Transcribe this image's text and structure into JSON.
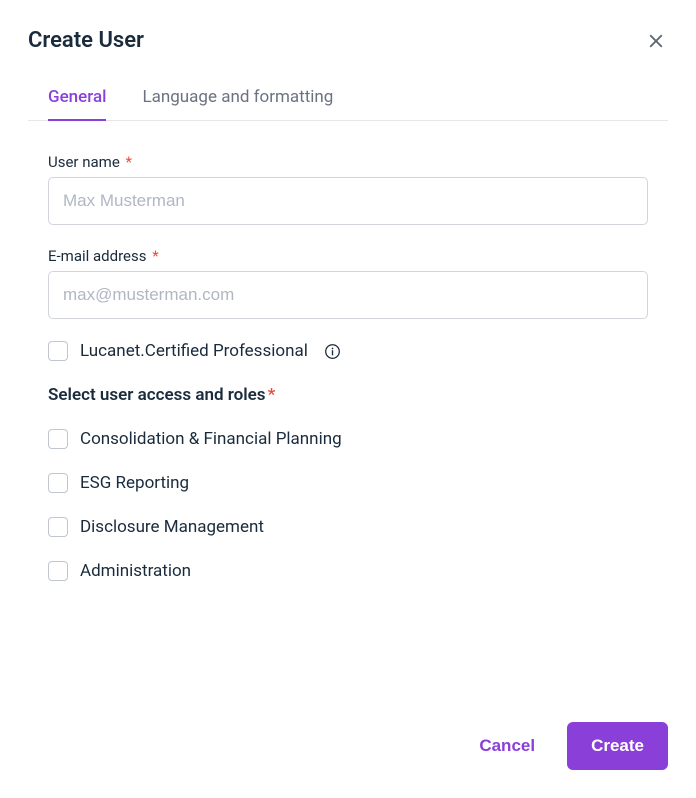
{
  "dialog": {
    "title": "Create User"
  },
  "tabs": {
    "general": "General",
    "language": "Language and formatting"
  },
  "fields": {
    "username": {
      "label": "User name",
      "placeholder": "Max Musterman"
    },
    "email": {
      "label": "E-mail address",
      "placeholder": "max@musterman.com"
    },
    "certified": {
      "label": "Lucanet.Certified Professional"
    }
  },
  "rolesHeading": "Select user access and roles",
  "roles": {
    "consolidation": "Consolidation & Financial Planning",
    "esg": "ESG Reporting",
    "disclosure": "Disclosure Management",
    "administration": "Administration"
  },
  "buttons": {
    "cancel": "Cancel",
    "create": "Create"
  }
}
